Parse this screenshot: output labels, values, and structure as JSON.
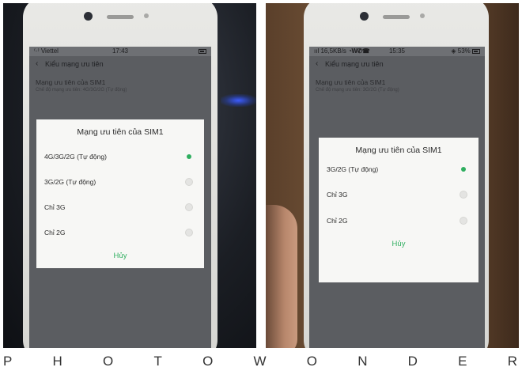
{
  "left": {
    "status": {
      "carrier": "Viettel",
      "time": "17:43"
    },
    "header": {
      "title": "Kiểu mạng ưu tiên"
    },
    "pref": {
      "title": "Mạng ưu tiên của SIM1",
      "subtitle": "Chế độ mạng ưu tiên: 4G/3G/2G (Tự động)"
    },
    "dialog": {
      "title": "Mạng ưu tiên của SIM1",
      "options": [
        {
          "label": "4G/3G/2G (Tự động)",
          "selected": true
        },
        {
          "label": "3G/2G (Tự động)",
          "selected": false
        },
        {
          "label": "Chỉ 3G",
          "selected": false
        },
        {
          "label": "Chỉ 2G",
          "selected": false
        }
      ],
      "cancel": "Hủy"
    }
  },
  "right": {
    "status": {
      "speed": "16,5KB/s",
      "time": "15:35",
      "battery": "53%"
    },
    "header": {
      "title": "Kiểu mạng ưu tiên"
    },
    "pref": {
      "title": "Mạng ưu tiên của SIM1",
      "subtitle": "Chế độ mạng ưu tiên: 3G/2G (Tự động)"
    },
    "dialog": {
      "title": "Mạng ưu tiên của SIM1",
      "options": [
        {
          "label": "3G/2G (Tự động)",
          "selected": true
        },
        {
          "label": "Chỉ 3G",
          "selected": false
        },
        {
          "label": "Chỉ 2G",
          "selected": false
        }
      ],
      "cancel": "Hủy"
    }
  },
  "watermark": [
    "P",
    "H",
    "O",
    "T",
    "O",
    "W",
    "O",
    "N",
    "D",
    "E",
    "R"
  ],
  "colors": {
    "accent": "#2fae5f",
    "dialog_bg": "#f7f7f5"
  }
}
